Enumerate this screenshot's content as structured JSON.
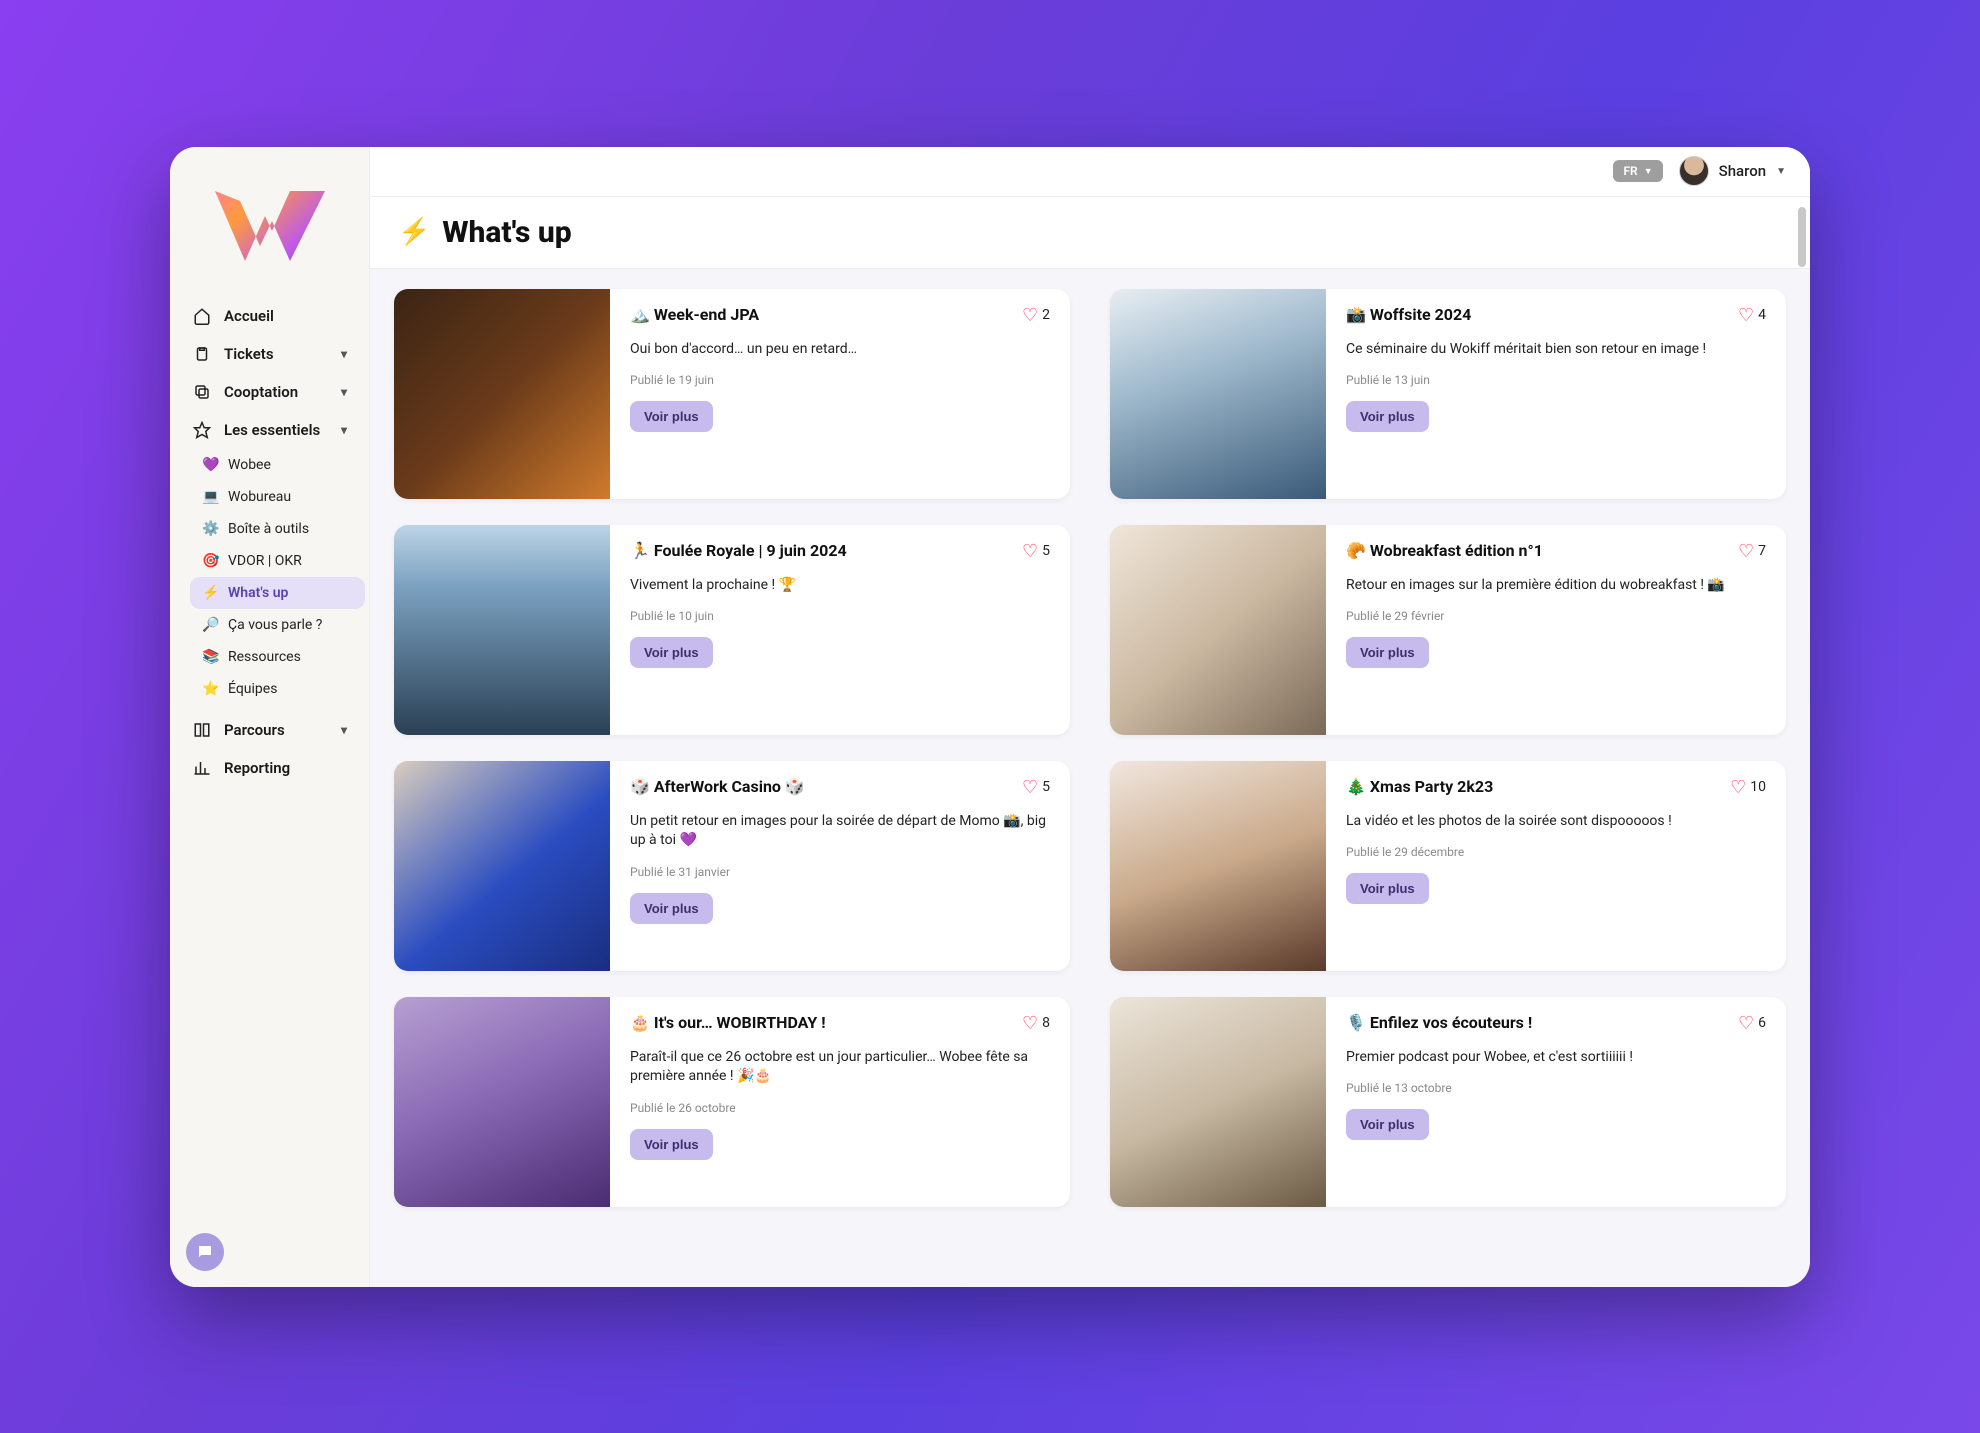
{
  "header": {
    "lang_label": "FR",
    "user_name": "Sharon"
  },
  "page": {
    "title": "What's up",
    "title_emoji": "⚡"
  },
  "sidebar": {
    "main": [
      {
        "icon": "home",
        "label": "Accueil",
        "expandable": false
      },
      {
        "icon": "clipboard",
        "label": "Tickets",
        "expandable": true
      },
      {
        "icon": "copy",
        "label": "Cooptation",
        "expandable": true
      },
      {
        "icon": "star",
        "label": "Les essentiels",
        "expandable": true
      }
    ],
    "essentials": [
      {
        "emoji": "💜",
        "label": "Wobee"
      },
      {
        "emoji": "💻",
        "label": "Wobureau"
      },
      {
        "emoji": "⚙️",
        "label": "Boîte à outils"
      },
      {
        "emoji": "🎯",
        "label": "VDOR | OKR"
      },
      {
        "emoji": "⚡",
        "label": "What's up",
        "active": true
      },
      {
        "emoji": "🔎",
        "label": "Ça vous parle ?"
      },
      {
        "emoji": "📚",
        "label": "Ressources"
      },
      {
        "emoji": "⭐",
        "label": "Équipes"
      }
    ],
    "tail": [
      {
        "icon": "layout",
        "label": "Parcours",
        "expandable": true
      },
      {
        "icon": "chart",
        "label": "Reporting",
        "expandable": false
      }
    ]
  },
  "buttons": {
    "see_more": "Voir plus"
  },
  "cards": [
    {
      "emoji": "🏔️",
      "title": "Week-end JPA",
      "likes": 2,
      "desc": "Oui bon d'accord… un peu en retard…",
      "date": "Publié le 19 juin",
      "img": "img1"
    },
    {
      "emoji": "📸",
      "title": "Woffsite 2024",
      "likes": 4,
      "desc": "Ce séminaire du Wokiff méritait bien son retour en image !",
      "date": "Publié le 13 juin",
      "img": "img2"
    },
    {
      "emoji": "🏃",
      "title": "Foulée Royale | 9 juin 2024",
      "likes": 5,
      "desc": "Vivement la prochaine ! 🏆",
      "date": "Publié le 10 juin",
      "img": "img3"
    },
    {
      "emoji": "🥐",
      "title": "Wobreakfast édition n°1",
      "likes": 7,
      "desc": "Retour en images sur la première édition du wobreakfast ! 📸",
      "date": "Publié le 29 février",
      "img": "img4"
    },
    {
      "emoji": "🎲",
      "title": "AfterWork Casino 🎲",
      "likes": 5,
      "desc": "Un petit retour en images pour la soirée de départ de Momo 📸, big up à toi 💜",
      "date": "Publié le 31 janvier",
      "img": "img5"
    },
    {
      "emoji": "🎄",
      "title": "Xmas Party 2k23",
      "likes": 10,
      "desc": "La vidéo et les photos de la soirée sont dispooooos !",
      "date": "Publié le 29 décembre",
      "img": "img6"
    },
    {
      "emoji": "🎂",
      "title": "It's our… WOBIRTHDAY !",
      "likes": 8,
      "desc": "Paraît-il que ce 26 octobre est un jour particulier… Wobee fête sa première année ! 🎉🎂",
      "date": "Publié le 26 octobre",
      "img": "img7"
    },
    {
      "emoji": "🎙️",
      "title": "Enfilez vos écouteurs !",
      "likes": 6,
      "desc": "Premier podcast pour Wobee, et c'est sortiiiiii !",
      "date": "Publié le 13 octobre",
      "img": "img8"
    }
  ]
}
